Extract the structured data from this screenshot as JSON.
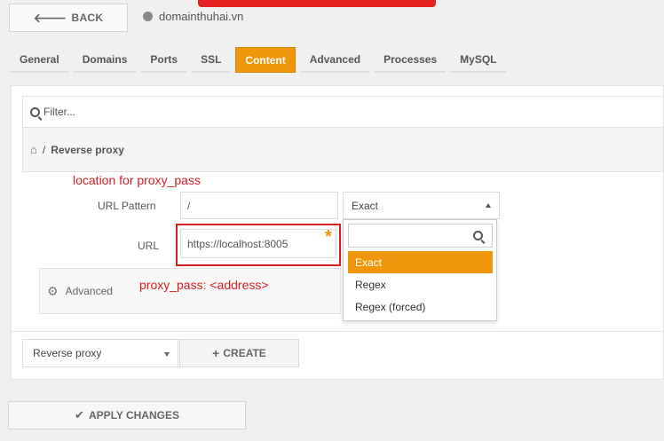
{
  "header": {
    "back_label": "BACK",
    "domain": "domainthuhai.vn",
    "icons": {
      "back": "arrow-left-icon",
      "domain": "globe-icon"
    }
  },
  "tabs": [
    {
      "label": "General",
      "active": false
    },
    {
      "label": "Domains",
      "active": false
    },
    {
      "label": "Ports",
      "active": false
    },
    {
      "label": "SSL",
      "active": false
    },
    {
      "label": "Content",
      "active": true
    },
    {
      "label": "Advanced",
      "active": false
    },
    {
      "label": "Processes",
      "active": false
    },
    {
      "label": "MySQL",
      "active": false
    }
  ],
  "filter": {
    "placeholder": "Filter..."
  },
  "breadcrumb": {
    "separator": "/",
    "current": "Reverse proxy",
    "home_icon": "home-icon"
  },
  "annotations": {
    "location_note": "location for proxy_pass",
    "address_note": "proxy_pass: <address>"
  },
  "form": {
    "url_pattern_label": "URL Pattern",
    "url_pattern_value": "/",
    "match_type_value": "Exact",
    "url_label": "URL",
    "url_value": "https://localhost:8005",
    "required_marker": "*"
  },
  "match_dropdown": {
    "options": [
      "Exact",
      "Regex",
      "Regex (forced)"
    ],
    "selected": "Exact"
  },
  "advanced_section": {
    "label": "Advanced",
    "icon": "gear-icon"
  },
  "actions": {
    "type_select_value": "Reverse proxy",
    "create_label": "CREATE",
    "apply_label": "APPLY CHANGES"
  },
  "colors": {
    "accent": "#f0960b",
    "annotation_red": "#d62020"
  }
}
